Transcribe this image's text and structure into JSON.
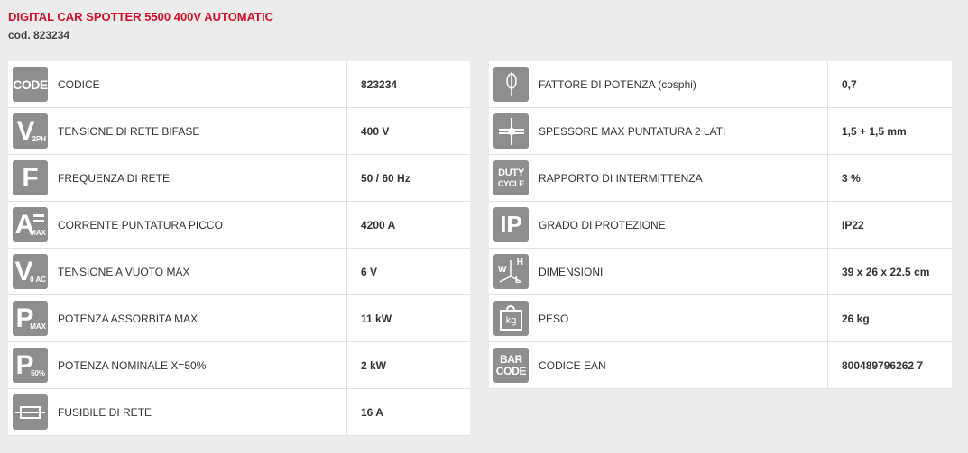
{
  "product": {
    "title": "DIGITAL CAR SPOTTER 5500 400V AUTOMATIC",
    "code": "cod. 823234"
  },
  "left_specs": [
    {
      "icon": "code-icon",
      "icon_text": "CODE",
      "label": "CODICE",
      "value": "823234"
    },
    {
      "icon": "voltage-2ph-icon",
      "icon_text": "V",
      "icon_sub": "2PH",
      "label": "TENSIONE DI RETE BIFASE",
      "value": "400 V"
    },
    {
      "icon": "frequency-icon",
      "icon_text": "F",
      "label": "FREQUENZA DI RETE",
      "value": "50 / 60 Hz"
    },
    {
      "icon": "current-max-icon",
      "icon_text": "A",
      "icon_sub": "MAX",
      "label": "CORRENTE PUNTATURA PICCO",
      "value": "4200 A"
    },
    {
      "icon": "voltage-no-load-icon",
      "icon_text": "V",
      "icon_sub": "0 AC",
      "label": "TENSIONE A VUOTO MAX",
      "value": "6 V"
    },
    {
      "icon": "power-max-icon",
      "icon_text": "P",
      "icon_sub": "MAX",
      "label": "POTENZA ASSORBITA MAX",
      "value": "11 kW"
    },
    {
      "icon": "power-50-icon",
      "icon_text": "P",
      "icon_sub": "50%",
      "label": "POTENZA NOMINALE X=50%",
      "value": "2 kW"
    },
    {
      "icon": "fuse-icon",
      "label": "FUSIBILE DI RETE",
      "value": "16 A"
    }
  ],
  "right_specs": [
    {
      "icon": "power-factor-icon",
      "label": "FATTORE DI POTENZA (cosphi)",
      "value": "0,7"
    },
    {
      "icon": "spot-thickness-icon",
      "label": "SPESSORE MAX PUNTATURA 2 LATI",
      "value": "1,5 + 1,5 mm"
    },
    {
      "icon": "duty-cycle-icon",
      "icon_text": "DUTY",
      "icon_text2": "CYCLE",
      "label": "RAPPORTO DI INTERMITTENZA",
      "value": "3 %"
    },
    {
      "icon": "ip-icon",
      "icon_text": "IP",
      "label": "GRADO DI PROTEZIONE",
      "value": "IP22"
    },
    {
      "icon": "dimensions-icon",
      "icon_text": "W",
      "icon_text2": "H",
      "icon_text3": "L",
      "label": "DIMENSIONI",
      "value": "39 x 26 x 22.5 cm"
    },
    {
      "icon": "weight-icon",
      "icon_text": "kg",
      "label": "PESO",
      "value": "26 kg"
    },
    {
      "icon": "barcode-icon",
      "icon_text": "BAR",
      "icon_text2": "CODE",
      "label": "CODICE EAN",
      "value": "800489796262 7"
    }
  ],
  "colors": {
    "accent": "#d0102a",
    "icon_bg": "#8e8e8e",
    "page_bg": "#ececec"
  }
}
